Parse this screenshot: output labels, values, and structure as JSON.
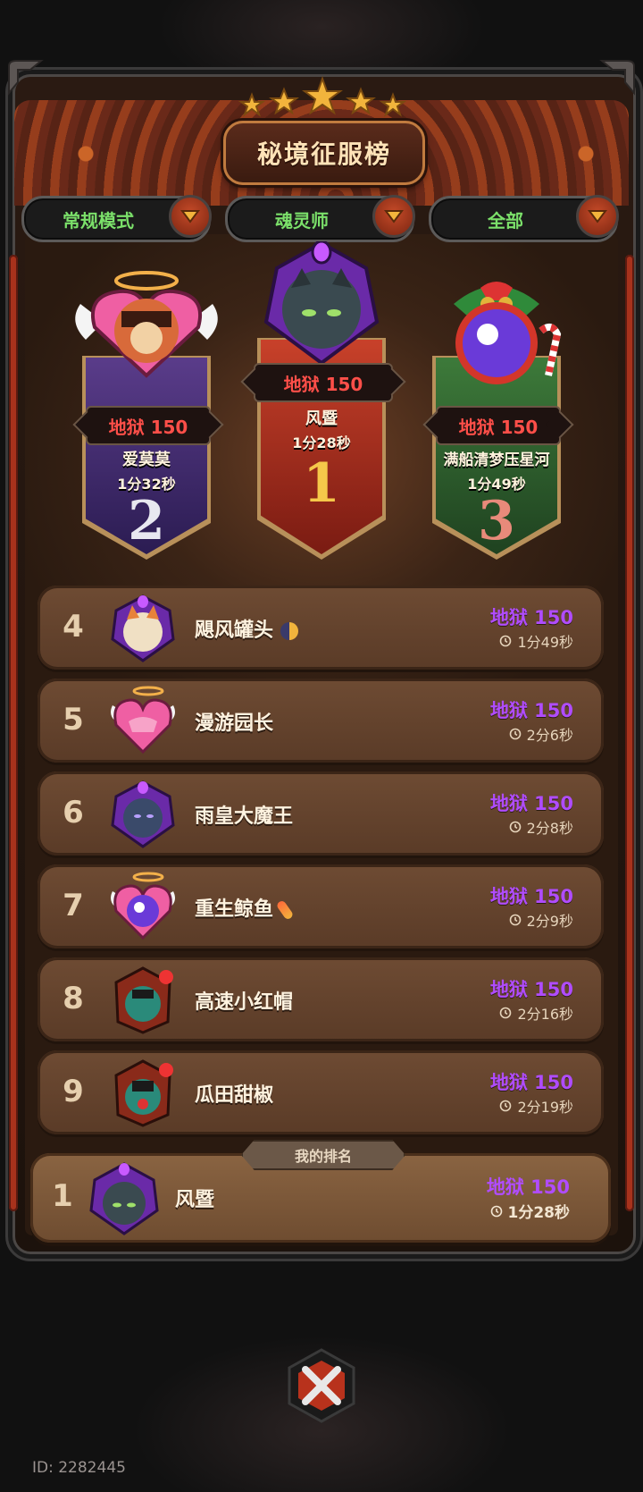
{
  "title": "秘境征服榜",
  "filters": [
    {
      "label": "常规模式"
    },
    {
      "label": "魂灵师"
    },
    {
      "label": "全部"
    }
  ],
  "podium": {
    "first": {
      "rank": "1",
      "score": "地狱 150",
      "name": "风暨",
      "time": "1分28秒"
    },
    "second": {
      "rank": "2",
      "score": "地狱 150",
      "name": "爱莫莫",
      "time": "1分32秒"
    },
    "third": {
      "rank": "3",
      "score": "地狱 150",
      "name": "满船清梦压星河",
      "time": "1分49秒"
    }
  },
  "rows": [
    {
      "rank": "4",
      "name": "飓风罐头",
      "score": "地狱 150",
      "time": "1分49秒"
    },
    {
      "rank": "5",
      "name": "漫游园长",
      "score": "地狱 150",
      "time": "2分6秒"
    },
    {
      "rank": "6",
      "name": "雨皇大魔王",
      "score": "地狱 150",
      "time": "2分8秒"
    },
    {
      "rank": "7",
      "name": "重生鲸鱼",
      "score": "地狱 150",
      "time": "2分9秒"
    },
    {
      "rank": "8",
      "name": "高速小红帽",
      "score": "地狱 150",
      "time": "2分16秒"
    },
    {
      "rank": "9",
      "name": "瓜田甜椒",
      "score": "地狱 150",
      "time": "2分19秒"
    }
  ],
  "my_rank": {
    "label": "我的排名",
    "rank": "1",
    "name": "风暨",
    "score": "地狱 150",
    "time": "1分28秒"
  },
  "player_id": "ID: 2282445",
  "colors": {
    "score_purple": "#b04cff",
    "score_red": "#ff4f49",
    "filter_green": "#7be06a",
    "rank_gold": "#f5c84a"
  }
}
